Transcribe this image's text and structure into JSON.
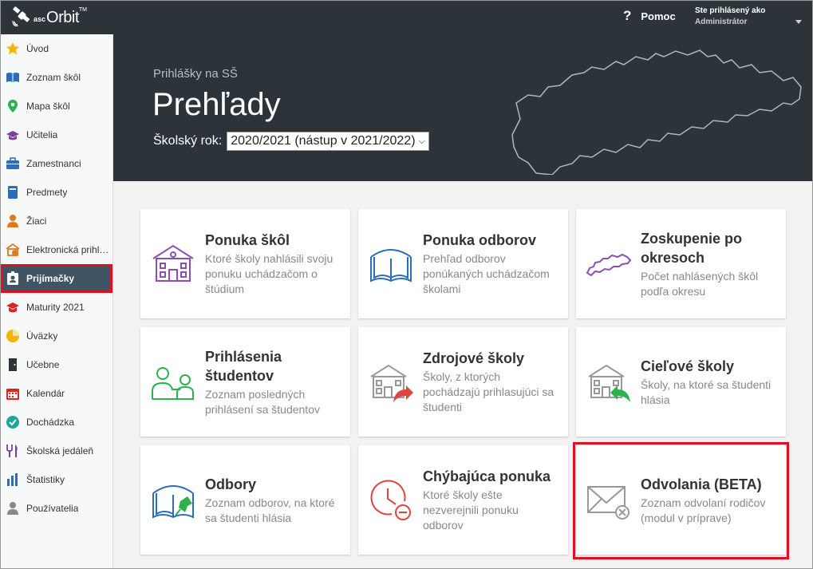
{
  "app": {
    "logo_prefix": "asc",
    "logo_name": "Orbit",
    "logo_tm": "TM"
  },
  "topbar": {
    "help_icon": "?",
    "help_label": "Pomoc",
    "user_line1": "Ste prihlásený ako",
    "user_line2": "Administrátor"
  },
  "sidebar": {
    "items": [
      {
        "label": "Úvod",
        "icon": "star-icon",
        "color": "#f4b400"
      },
      {
        "label": "Zoznam škôl",
        "icon": "book-icon",
        "color": "#2a6ebb"
      },
      {
        "label": "Mapa škôl",
        "icon": "map-pin-icon",
        "color": "#2bb24c"
      },
      {
        "label": "Učitelia",
        "icon": "graduation-cap-icon",
        "color": "#7b3fa0"
      },
      {
        "label": "Zamestnanci",
        "icon": "briefcase-icon",
        "color": "#2a6ebb"
      },
      {
        "label": "Predmety",
        "icon": "notebook-icon",
        "color": "#2a6ebb"
      },
      {
        "label": "Žiaci",
        "icon": "student-icon",
        "color": "#e07a1e"
      },
      {
        "label": "Elektronická prihláška",
        "icon": "school-online-icon",
        "color": "#e07a1e"
      },
      {
        "label": "Prijímačky",
        "icon": "badge-icon",
        "color": "#ffffff"
      },
      {
        "label": "Maturity 2021",
        "icon": "mortarboard-icon",
        "color": "#e02424"
      },
      {
        "label": "Úväzky",
        "icon": "pie-chart-icon",
        "color": "#f4b400"
      },
      {
        "label": "Učebne",
        "icon": "door-icon",
        "color": "#2d3439"
      },
      {
        "label": "Kalendár",
        "icon": "calendar-icon",
        "color": "#e02424"
      },
      {
        "label": "Dochádzka",
        "icon": "check-circle-icon",
        "color": "#1aa898"
      },
      {
        "label": "Školská jedáleň",
        "icon": "cutlery-icon",
        "color": "#7b3fa0"
      },
      {
        "label": "Štatistiky",
        "icon": "bar-chart-icon",
        "color": "#2a6ebb"
      },
      {
        "label": "Používatelia",
        "icon": "user-icon",
        "color": "#888888"
      }
    ],
    "active_index": 8
  },
  "hero": {
    "subtitle": "Prihlášky na SŠ",
    "title": "Prehľady",
    "year_label": "Školský rok:",
    "year_value": "2020/2021 (nástup v 2021/2022)"
  },
  "cards": [
    {
      "title": "Ponuka škôl",
      "desc": "Ktoré školy nahlásili svoju ponuku uchádzačom o štúdium",
      "icon": "school-building-icon",
      "color": "#8a4fb5"
    },
    {
      "title": "Ponuka odborov",
      "desc": "Prehľad odborov ponúkaných uchádzačom školami",
      "icon": "open-book-icon",
      "color": "#2a6ebb"
    },
    {
      "title": "Zoskupenie po okresoch",
      "desc": "Počet nahlásených škôl podľa okresu",
      "icon": "slovakia-map-icon",
      "color": "#8a4fb5"
    },
    {
      "title": "Prihlásenia študentov",
      "desc": "Zoznam posledných prihlásení sa študentov",
      "icon": "students-icon",
      "color": "#2bb24c"
    },
    {
      "title": "Zdrojové školy",
      "desc": "Školy, z ktorých pochádzajú prihlasujúci sa študenti",
      "icon": "school-export-icon",
      "color": "#e0443e"
    },
    {
      "title": "Cieľové školy",
      "desc": "Školy, na ktoré sa študenti hlásia",
      "icon": "school-import-icon",
      "color": "#2bb24c"
    },
    {
      "title": "Odbory",
      "desc": "Zoznam odborov, na ktoré sa študenti hlásia",
      "icon": "book-pin-icon",
      "color": "#2a6ebb"
    },
    {
      "title": "Chýbajúca ponuka",
      "desc": "Ktoré školy ešte nezverejnili ponuku odborov",
      "icon": "clock-minus-icon",
      "color": "#e0443e"
    },
    {
      "title": "Odvolania (BETA)",
      "desc": "Zoznam odvolaní rodičov (modul v príprave)",
      "icon": "envelope-cancel-icon",
      "color": "#999999"
    }
  ],
  "highlighted_card": 8
}
